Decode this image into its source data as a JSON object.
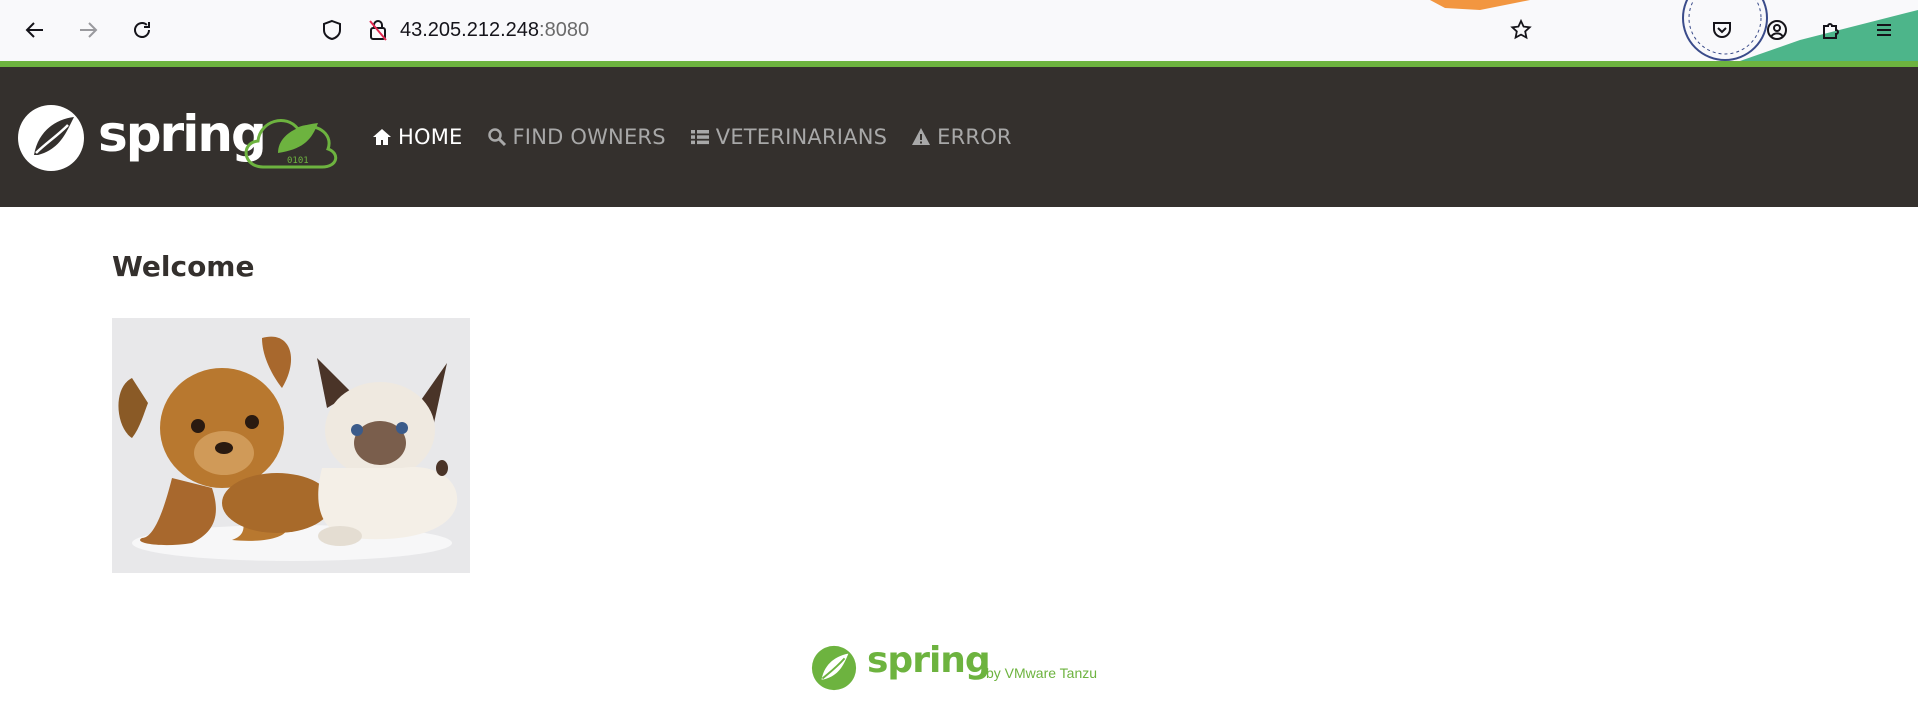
{
  "browser": {
    "url_host": "43.205.212.248",
    "url_port": ":8080"
  },
  "navbar": {
    "brand": "spring",
    "items": [
      {
        "label": "HOME",
        "icon": "home-icon",
        "active": true
      },
      {
        "label": "FIND OWNERS",
        "icon": "search-icon",
        "active": false
      },
      {
        "label": "VETERINARIANS",
        "icon": "list-icon",
        "active": false
      },
      {
        "label": "ERROR",
        "icon": "warning-icon",
        "active": false
      }
    ]
  },
  "main": {
    "heading": "Welcome",
    "image": "pets-dog-and-cat"
  },
  "footer": {
    "brand": "spring",
    "by": "by VMware Tanzu"
  },
  "colors": {
    "navbar_bg": "#34302d",
    "spring_green": "#6db33f",
    "nav_inactive": "#a8a8a8",
    "nav_active": "#ffffff"
  }
}
